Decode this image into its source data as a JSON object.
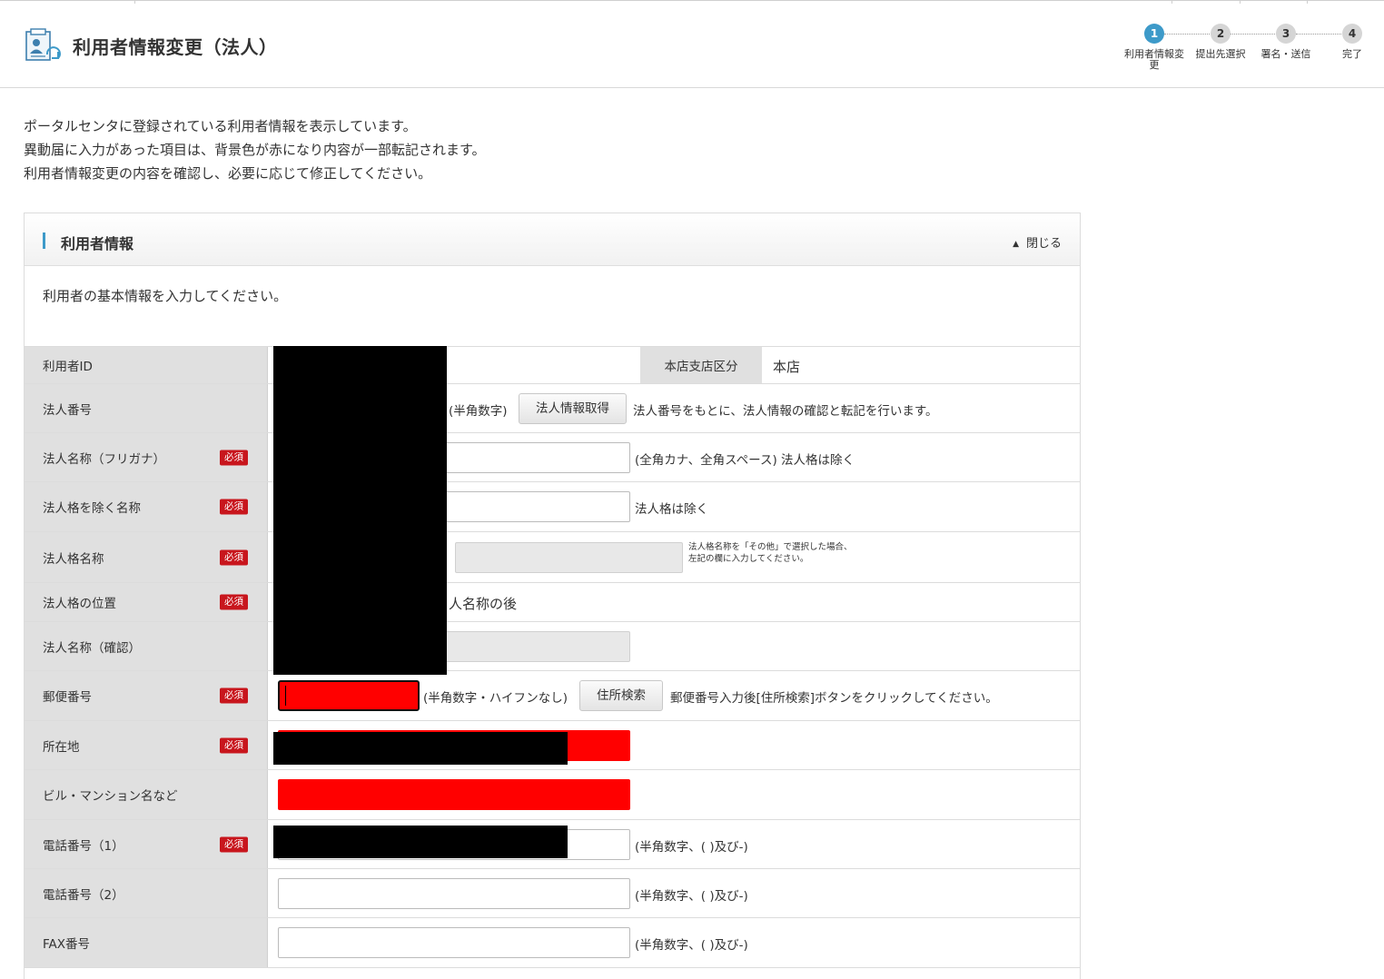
{
  "header": {
    "title": "利用者情報変更（法人）",
    "steps": [
      {
        "num": "1",
        "label": "利用者情報変更"
      },
      {
        "num": "2",
        "label": "提出先選択"
      },
      {
        "num": "3",
        "label": "署名・送信"
      },
      {
        "num": "4",
        "label": "完了"
      }
    ]
  },
  "intro": [
    "ポータルセンタに登録されている利用者情報を表示しています。",
    "異動届に入力があった項目は、背景色が赤になり内容が一部転記されます。",
    "利用者情報変更の内容を確認し、必要に応じて修正してください。"
  ],
  "panel": {
    "title": "利用者情報",
    "close_label": "閉じる",
    "description": "利用者の基本情報を入力してください。"
  },
  "required_label": "必須",
  "form": {
    "user_id": {
      "label": "利用者ID"
    },
    "branch": {
      "label": "本店支店区分",
      "value": "本店"
    },
    "corp_number": {
      "label": "法人番号",
      "hint": "(半角数字)",
      "button": "法人情報取得",
      "note": "法人番号をもとに、法人情報の確認と転記を行います。"
    },
    "corp_name_kana": {
      "label": "法人名称（フリガナ）",
      "note": "(全角カナ、全角スペース)  法人格は除く"
    },
    "corp_name": {
      "label": "法人格を除く名称",
      "note": "法人格は除く"
    },
    "corp_type": {
      "label": "法人格名称",
      "note_line1": "法人格名称を「その他」で選択した場合、",
      "note_line2": "左記の欄に入力してください。"
    },
    "corp_type_position": {
      "label": "法人格の位置",
      "value_fragment": "人名称の後"
    },
    "corp_name_confirm": {
      "label": "法人名称（確認）"
    },
    "postal_code": {
      "label": "郵便番号",
      "hint": "(半角数字・ハイフンなし)",
      "button": "住所検索",
      "note": "郵便番号入力後[住所検索]ボタンをクリックしてください。"
    },
    "address": {
      "label": "所在地"
    },
    "building": {
      "label": "ビル・マンション名など"
    },
    "phone1": {
      "label": "電話番号（1）",
      "note": "(半角数字、(  )及び-)"
    },
    "phone2": {
      "label": "電話番号（2）",
      "note": "(半角数字、(  )及び-)"
    },
    "fax": {
      "label": "FAX番号",
      "note": "(半角数字、(  )及び-)"
    }
  }
}
